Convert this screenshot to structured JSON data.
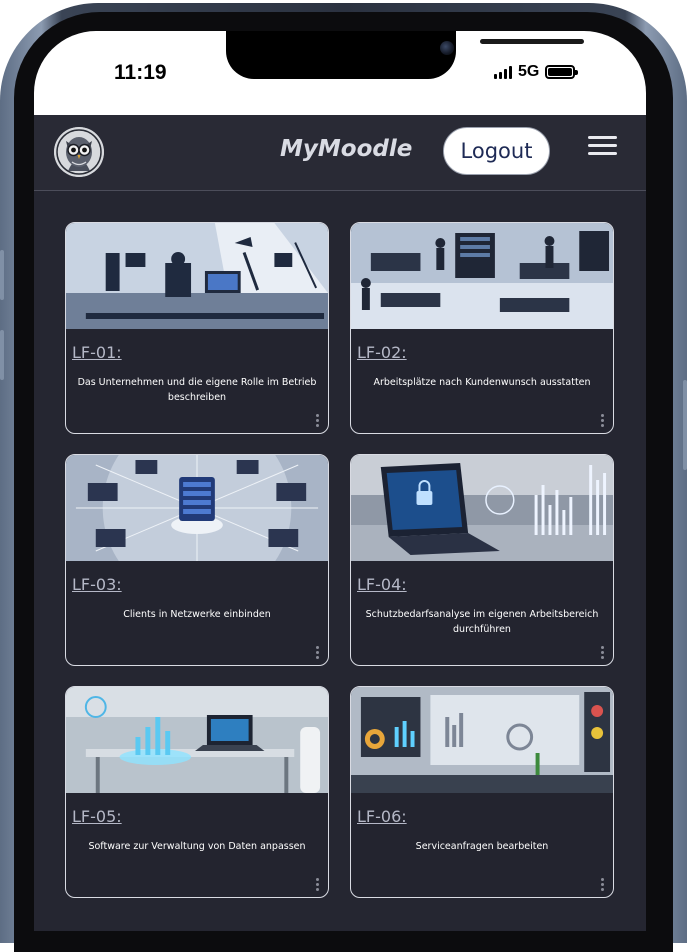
{
  "status_bar": {
    "time": "11:19",
    "network": "5G"
  },
  "header": {
    "title": "MyMoodle",
    "logout_label": "Logout"
  },
  "courses": [
    {
      "code": "LF-01:",
      "description": "Das Unternehmen und die eigene Rolle im Betrieb beschreiben"
    },
    {
      "code": "LF-02:",
      "description": "Arbeitsplätze nach Kundenwunsch ausstatten"
    },
    {
      "code": "LF-03:",
      "description": "Clients in Netzwerke einbinden"
    },
    {
      "code": "LF-04:",
      "description": "Schutzbedarfsanalyse im eigenen Arbeitsbereich durchführen"
    },
    {
      "code": "LF-05:",
      "description": "Software zur Verwaltung von Daten anpassen"
    },
    {
      "code": "LF-06:",
      "description": "Serviceanfragen bearbeiten"
    }
  ],
  "icons": {
    "avatar": "owl-avatar-icon",
    "menu": "hamburger-menu-icon",
    "more": "vertical-dots-icon"
  },
  "colors": {
    "background": "#252631",
    "header": "#292a35",
    "logout_text": "#1e2a55",
    "card_border": "#d9dbe3"
  }
}
